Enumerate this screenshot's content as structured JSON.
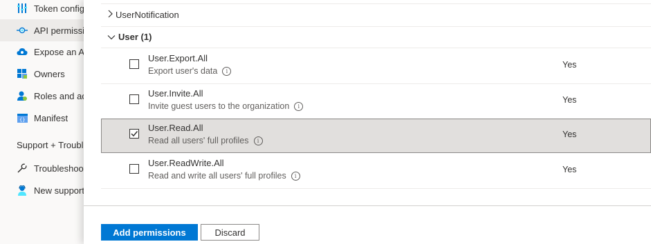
{
  "sidebar": {
    "items": [
      {
        "label": "Token configuration",
        "icon": "token-config-icon"
      },
      {
        "label": "API permissions",
        "icon": "api-permissions-icon",
        "active": true
      },
      {
        "label": "Expose an API",
        "icon": "cloud-icon"
      },
      {
        "label": "Owners",
        "icon": "owners-icon"
      },
      {
        "label": "Roles and administrators",
        "icon": "roles-icon"
      },
      {
        "label": "Manifest",
        "icon": "manifest-icon"
      }
    ],
    "support_section": "Support + Troubleshooting",
    "support_items": [
      {
        "label": "Troubleshooting",
        "icon": "wrench-icon"
      },
      {
        "label": "New support request",
        "icon": "support-person-icon"
      }
    ]
  },
  "groups": {
    "collapsed": {
      "label": "UserNotification",
      "chevron": "chevron-right-icon"
    },
    "expanded": {
      "label": "User (1)",
      "chevron": "chevron-down-icon"
    }
  },
  "permissions": [
    {
      "name": "User.Export.All",
      "description": "Export user's data",
      "admin_consent": "Yes",
      "checked": false
    },
    {
      "name": "User.Invite.All",
      "description": "Invite guest users to the organization",
      "admin_consent": "Yes",
      "checked": false
    },
    {
      "name": "User.Read.All",
      "description": "Read all users' full profiles",
      "admin_consent": "Yes",
      "checked": true
    },
    {
      "name": "User.ReadWrite.All",
      "description": "Read and write all users' full profiles",
      "admin_consent": "Yes",
      "checked": false
    }
  ],
  "buttons": {
    "add_permissions": "Add permissions",
    "discard": "Discard"
  },
  "colors": {
    "primary": "#0078d4",
    "selected_row": "#e1dfdd",
    "sidebar_bg": "#faf9f8"
  }
}
